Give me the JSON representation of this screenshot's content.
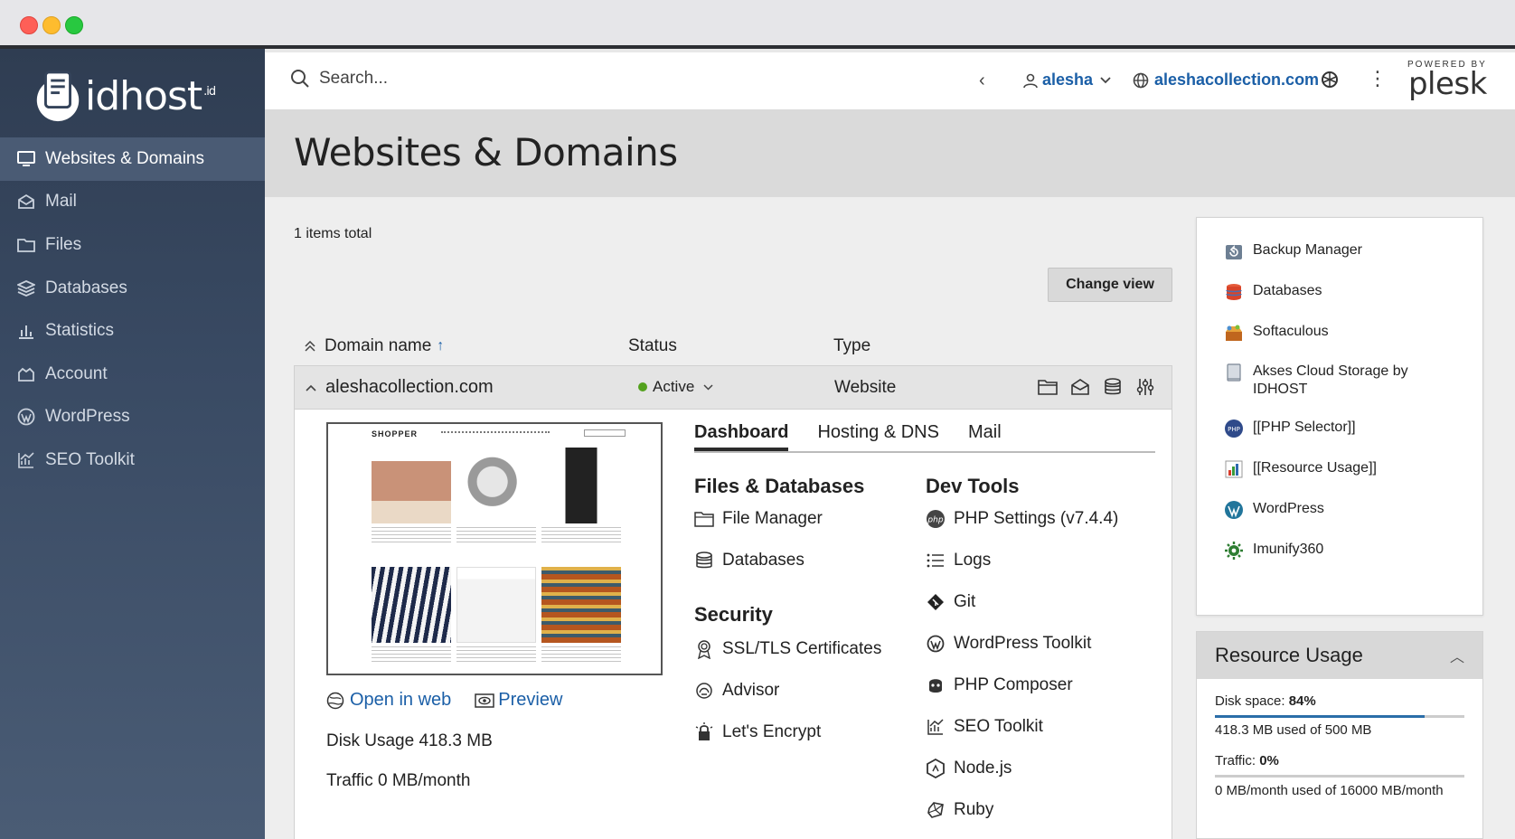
{
  "window": {
    "title": ""
  },
  "brand": {
    "logo_text": "idhost",
    "logo_sup": ".id"
  },
  "sidebar": {
    "items": [
      {
        "label": "Websites & Domains",
        "icon": "monitor-icon",
        "active": true
      },
      {
        "label": "Mail",
        "icon": "mail-icon"
      },
      {
        "label": "Files",
        "icon": "folder-icon"
      },
      {
        "label": "Databases",
        "icon": "database-icon"
      },
      {
        "label": "Statistics",
        "icon": "bar-chart-icon"
      },
      {
        "label": "Account",
        "icon": "account-icon"
      },
      {
        "label": "WordPress",
        "icon": "wordpress-icon"
      },
      {
        "label": "SEO Toolkit",
        "icon": "seo-chart-icon"
      }
    ]
  },
  "topbar": {
    "search_placeholder": "Search...",
    "user": "alesha",
    "domain": "aleshacollection.com",
    "powered_by": "POWERED BY",
    "plesk": "plesk"
  },
  "page": {
    "title": "Websites & Domains",
    "items_total": "1 items total",
    "change_view": "Change view"
  },
  "table": {
    "headers": {
      "domain": "Domain name",
      "sort_arrow": "↑",
      "status": "Status",
      "type": "Type"
    },
    "row": {
      "domain": "aleshacollection.com",
      "status": "Active",
      "type": "Website",
      "status_color": "#53a11d"
    }
  },
  "preview": {
    "brand": "SHOPPER",
    "open_in_web": "Open in web",
    "preview": "Preview",
    "disk_usage_label": "Disk Usage",
    "disk_usage_value": "418.3 MB",
    "traffic_label": "Traffic",
    "traffic_value": "0 MB/month"
  },
  "tabs": [
    "Dashboard",
    "Hosting & DNS",
    "Mail"
  ],
  "groups": {
    "files_db": {
      "title": "Files & Databases",
      "items": [
        "File Manager",
        "Databases"
      ]
    },
    "security": {
      "title": "Security",
      "items": [
        "SSL/TLS Certificates",
        "Advisor",
        "Let's Encrypt"
      ]
    },
    "dev": {
      "title": "Dev Tools",
      "items": [
        "PHP Settings (v7.4.4)",
        "Logs",
        "Git",
        "WordPress Toolkit",
        "PHP Composer",
        "SEO Toolkit",
        "Node.js",
        "Ruby"
      ]
    }
  },
  "tools": [
    {
      "label": "Backup Manager",
      "icon": "backup-icon"
    },
    {
      "label": "Databases",
      "icon": "database-icon"
    },
    {
      "label": "Softaculous",
      "icon": "softaculous-icon"
    },
    {
      "label": "Akses Cloud Storage by IDHOST",
      "icon": "cloud-storage-icon"
    },
    {
      "label": "[[PHP Selector]]",
      "icon": "php-icon"
    },
    {
      "label": "[[Resource Usage]]",
      "icon": "resource-chart-icon"
    },
    {
      "label": "WordPress",
      "icon": "wordpress-icon"
    },
    {
      "label": "Imunify360",
      "icon": "imunify-icon"
    }
  ],
  "resource_usage": {
    "title": "Resource Usage",
    "disk_label": "Disk space:",
    "disk_pct": "84%",
    "disk_fraction": 0.84,
    "disk_detail": "418.3 MB used of 500 MB",
    "traffic_label": "Traffic:",
    "traffic_pct": "0%",
    "traffic_fraction": 0,
    "traffic_detail": "0 MB/month used of 16000 MB/month"
  }
}
